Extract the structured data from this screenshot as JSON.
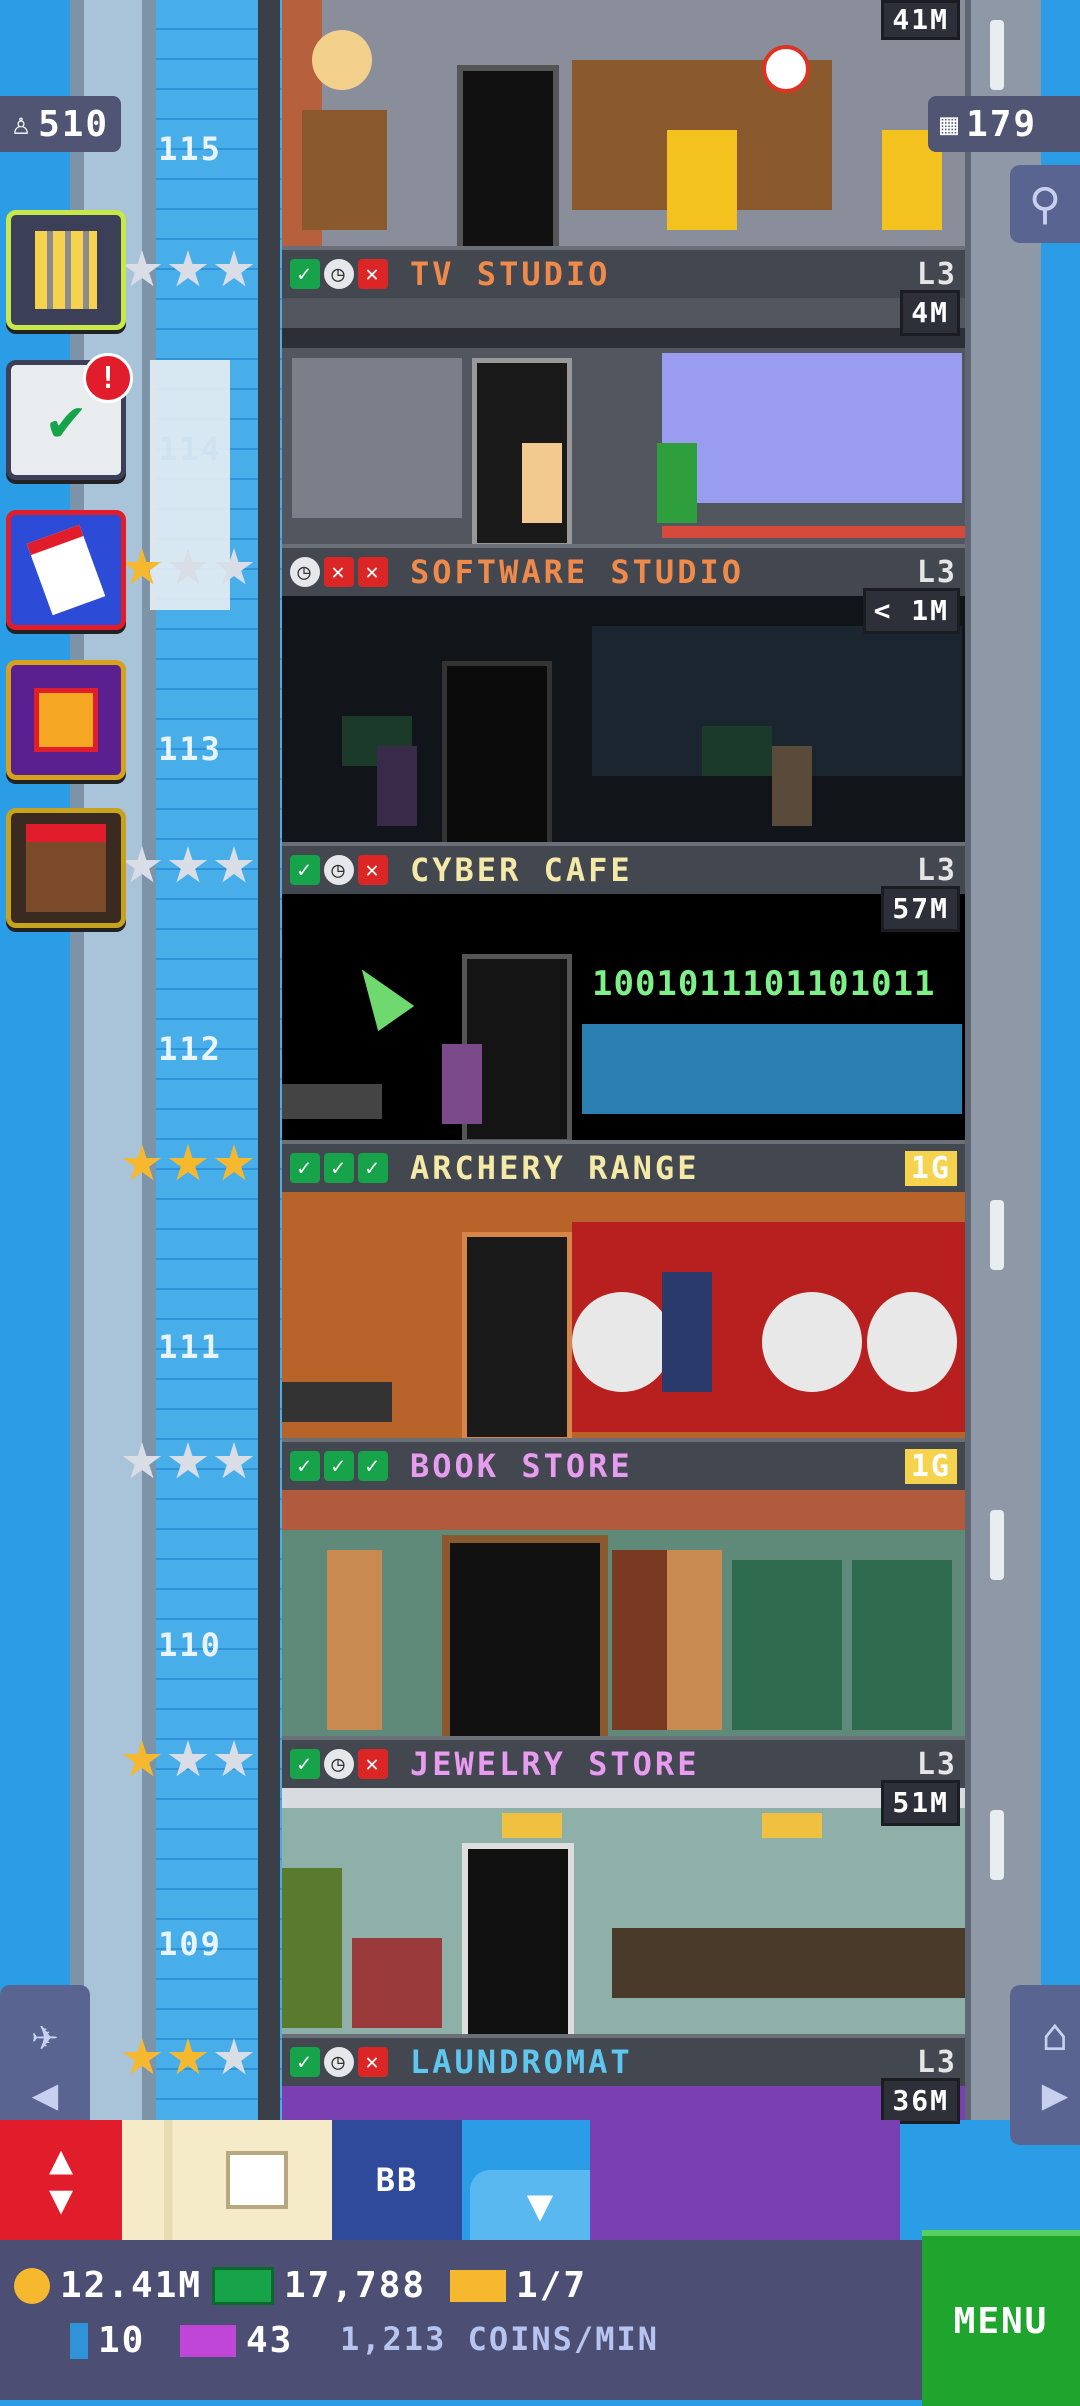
{
  "top_counters": {
    "population": "510",
    "floors_count": "179"
  },
  "top_floor": {
    "stock": "41M"
  },
  "floors": [
    {
      "number": "115",
      "name": "TV STUDIO",
      "name_color": "#f08a4b",
      "level": "L3",
      "stock": "4M",
      "status": [
        "check",
        "clock",
        "x"
      ],
      "stars": [
        "silver",
        "silver",
        "silver"
      ]
    },
    {
      "number": "114",
      "name": "SOFTWARE STUDIO",
      "name_color": "#f08a4b",
      "level": "L3",
      "stock": "< 1M",
      "status": [
        "clock",
        "x",
        "x"
      ],
      "stars": [
        "gold",
        "silver",
        "silver"
      ]
    },
    {
      "number": "113",
      "name": "CYBER CAFE",
      "name_color": "#f5e9a8",
      "level": "L3",
      "stock": "57M",
      "status": [
        "check",
        "clock",
        "x"
      ],
      "stars": [
        "silver",
        "silver",
        "silver"
      ]
    },
    {
      "number": "112",
      "name": "ARCHERY RANGE",
      "name_color": "#f5e9a8",
      "level": "1G",
      "level_gold": true,
      "stock": "",
      "status": [
        "check",
        "check",
        "check"
      ],
      "stars": [
        "gold",
        "gold",
        "gold"
      ]
    },
    {
      "number": "111",
      "name": "BOOK STORE",
      "name_color": "#e79cf0",
      "level": "1G",
      "level_gold": true,
      "stock": "",
      "status": [
        "check",
        "check",
        "check"
      ],
      "stars": [
        "silver",
        "silver",
        "silver"
      ]
    },
    {
      "number": "110",
      "name": "JEWELRY STORE",
      "name_color": "#e79cf0",
      "level": "L3",
      "stock": "51M",
      "status": [
        "check",
        "clock",
        "x"
      ],
      "stars": [
        "gold",
        "silver",
        "silver"
      ]
    },
    {
      "number": "109",
      "name": "LAUNDROMAT",
      "name_color": "#5fc7ef",
      "level": "L3",
      "stock": "36M",
      "status": [
        "check",
        "clock",
        "x"
      ],
      "stars": [
        "gold",
        "gold",
        "silver"
      ]
    }
  ],
  "room_texts": {
    "binary_sign": "1001011101101011"
  },
  "side_buttons": [
    {
      "icon": "building-icon"
    },
    {
      "icon": "checklist-icon",
      "badge": "!"
    },
    {
      "icon": "calendar-icon"
    },
    {
      "icon": "gift-icon"
    },
    {
      "icon": "shop-stall-icon"
    }
  ],
  "toolbar": {
    "bb_label": "BB"
  },
  "status": {
    "coins": "12.41M",
    "bux": "17,788",
    "tickets": "1/7",
    "gems": "10",
    "vip": "43",
    "rate": "1,213 COINS/MIN"
  },
  "menu_label": "MENU",
  "colors": {
    "gold_star": "#f5b82e",
    "silver_star": "#d8dde6",
    "menu_green": "#1fa52d"
  }
}
